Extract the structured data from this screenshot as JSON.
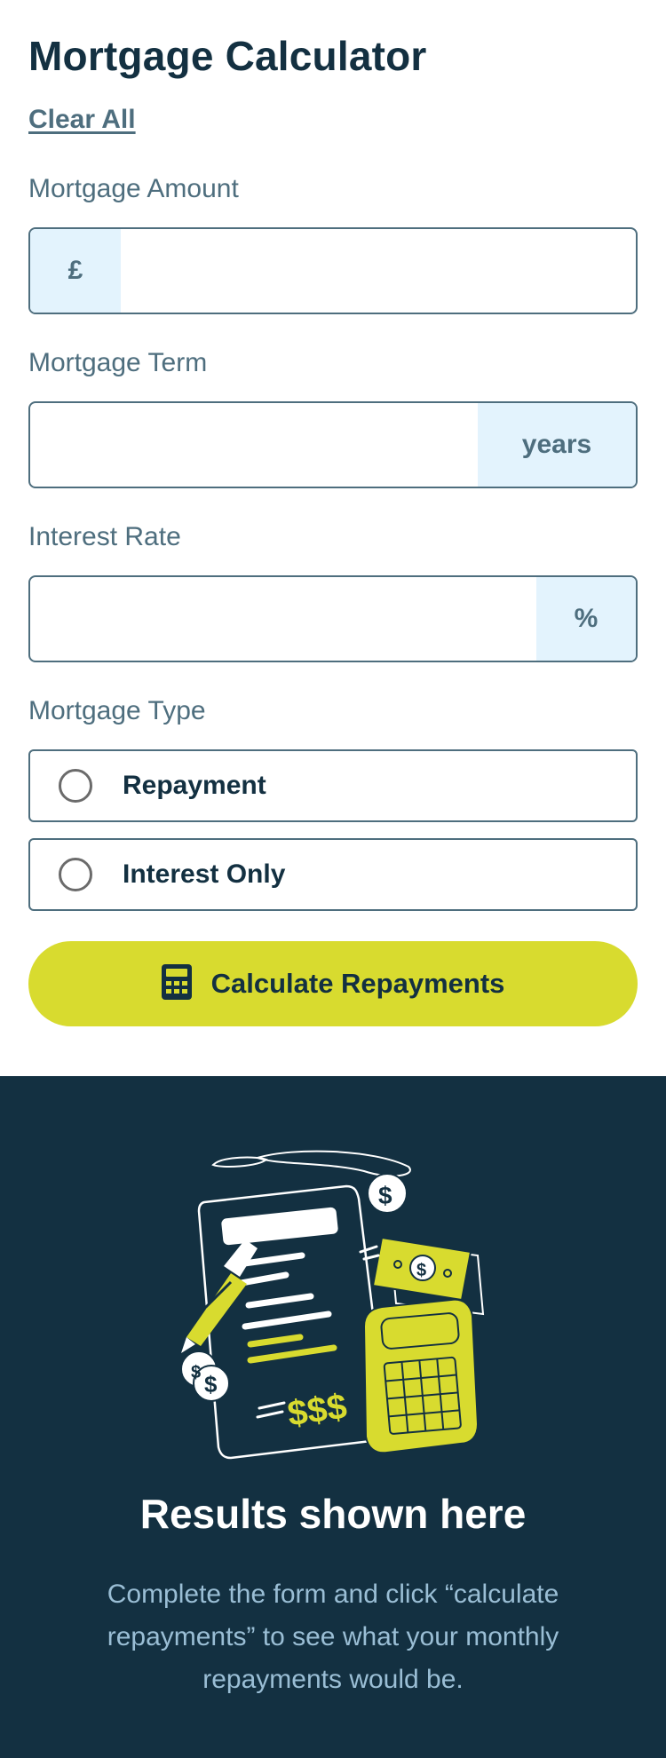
{
  "header": {
    "title": "Mortgage Calculator",
    "clear_label": "Clear All"
  },
  "fields": {
    "amount": {
      "label": "Mortgage Amount",
      "prefix": "£",
      "value": ""
    },
    "term": {
      "label": "Mortgage Term",
      "suffix": "years",
      "value": ""
    },
    "rate": {
      "label": "Interest Rate",
      "suffix": "%",
      "value": ""
    }
  },
  "mortgage_type": {
    "label": "Mortgage Type",
    "options": [
      {
        "label": "Repayment",
        "selected": false
      },
      {
        "label": "Interest Only",
        "selected": false
      }
    ]
  },
  "calculate": {
    "label": "Calculate Repayments",
    "icon": "calculator-icon"
  },
  "results": {
    "illustration": "empty-results-illustration",
    "title": "Results shown here",
    "description": "Complete the form and click “calculate repayments” to see what your monthly repayments would be."
  },
  "colors": {
    "navy": "#133041",
    "slate": "#4e6e7e",
    "lime": "#d8db2f",
    "light_blue": "#e3f3fd",
    "muted_text": "#9abed5"
  }
}
